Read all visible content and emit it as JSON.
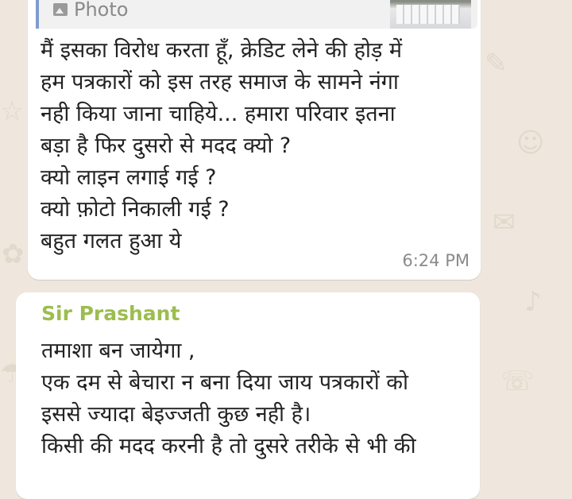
{
  "messages": [
    {
      "quoted": {
        "label": "Photo",
        "icon": "photo-icon"
      },
      "text": "मैं इसका विरोध करता हूँ, क्रेडिट लेने की होड़ में\nहम पत्रकारों को इस तरह समाज के सामने नंगा\nनही किया जाना चाहिये... हमारा परिवार इतना\nबड़ा है फिर दुसरो से मदद क्यो ?\nक्यो लाइन लगाई गई ?\nक्यो फ़ोटो निकाली गई ?\nबहुत गलत हुआ ये",
      "time": "6:24 PM"
    },
    {
      "sender": "Sir Prashant",
      "text": "तमाशा बन जायेगा ,\nएक दम से बेचारा न बना दिया जाय पत्रकारों को\nइससे ज्यादा बेइज्जती कुछ नही है।\nकिसी की मदद करनी है तो दुसरे तरीके से भी की"
    }
  ],
  "colors": {
    "sender": "#9cbd4f",
    "quote_border": "#7e9ccf",
    "background": "#efe7dd"
  }
}
